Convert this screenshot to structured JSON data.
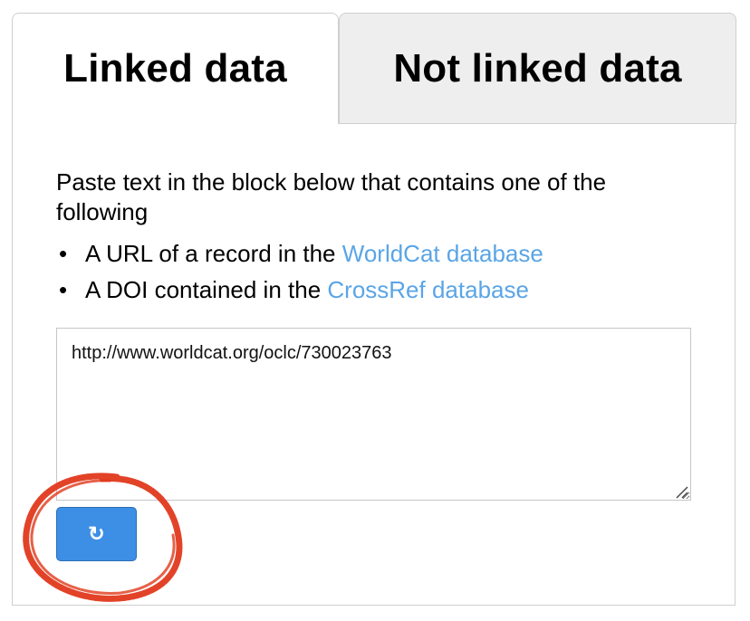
{
  "tabs": {
    "linked_label": "Linked data",
    "not_linked_label": "Not linked data"
  },
  "intro": {
    "text": "Paste text in the block below that contains one of the following"
  },
  "list": {
    "items": [
      {
        "prefix": "A URL of a record in the ",
        "link": "WorldCat database"
      },
      {
        "prefix": "A DOI contained in the ",
        "link": "CrossRef database"
      }
    ]
  },
  "input": {
    "value": "http://www.worldcat.org/oclc/730023763"
  },
  "refresh_button": {
    "icon": "refresh-icon",
    "symbol": "↻"
  },
  "colors": {
    "link": "#5aa5e6",
    "button": "#3d8ee5",
    "annotation": "#e0391c",
    "inactive_tab": "#eeeeee"
  }
}
